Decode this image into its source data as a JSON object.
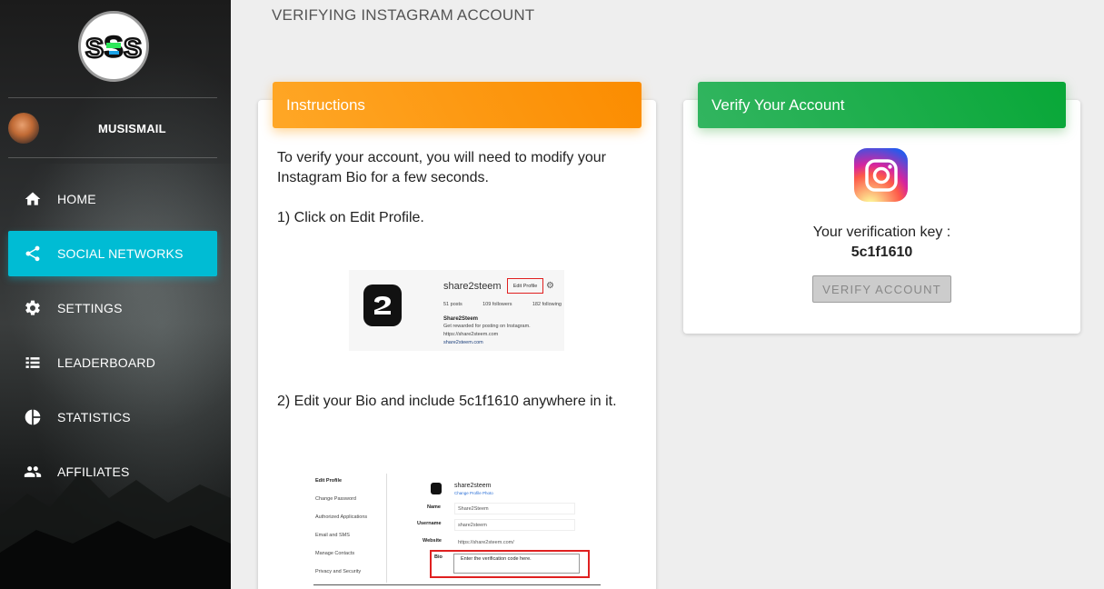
{
  "page": {
    "title": "VERIFYING INSTAGRAM ACCOUNT"
  },
  "sidebar": {
    "logo_text": "S2S",
    "user": {
      "name": "MUSISMAIL"
    },
    "items": [
      {
        "label": "HOME",
        "icon": "home-icon",
        "active": false
      },
      {
        "label": "SOCIAL NETWORKS",
        "icon": "share-icon",
        "active": true
      },
      {
        "label": "SETTINGS",
        "icon": "gear-icon",
        "active": false
      },
      {
        "label": "LEADERBOARD",
        "icon": "list-icon",
        "active": false
      },
      {
        "label": "STATISTICS",
        "icon": "pie-chart-icon",
        "active": false
      },
      {
        "label": "AFFILIATES",
        "icon": "people-icon",
        "active": false
      }
    ],
    "active_color": "#00bcd4"
  },
  "instructions": {
    "header": "Instructions",
    "intro": "To verify your account, you will need to modify your Instagram Bio for a few seconds.",
    "step1": "1) Click on Edit Profile.",
    "step2": "2) Edit your Bio and include 5c1f1610 anywhere in it.",
    "shot1": {
      "username": "share2steem",
      "edit_button": "Edit Profile",
      "posts": "51 posts",
      "followers": "109 followers",
      "following": "182 following",
      "name": "Share2Steem",
      "description": "Get rewarded for posting on Instagram.",
      "url_plain": "https://share2steem.com",
      "url_link": "share2steem.com"
    },
    "shot2": {
      "menu": [
        "Edit Profile",
        "Change Password",
        "Authorized Applications",
        "Email and SMS",
        "Manage Contacts",
        "Privacy and Security"
      ],
      "profile_name": "share2steem",
      "change_photo": "Change Profile Photo",
      "fields": [
        {
          "label": "Name",
          "value": "Share2Steem"
        },
        {
          "label": "Username",
          "value": "share2steem"
        },
        {
          "label": "Website",
          "value": "https://share2steem.com/"
        },
        {
          "label": "Bio",
          "value": "Enter the verification code here."
        }
      ]
    },
    "header_color": "#fb8c00"
  },
  "verify": {
    "header": "Verify Your Account",
    "key_label": "Your verification key :",
    "key_value": "5c1f1610",
    "button_label": "VERIFY ACCOUNT",
    "header_color": "#08a737"
  }
}
